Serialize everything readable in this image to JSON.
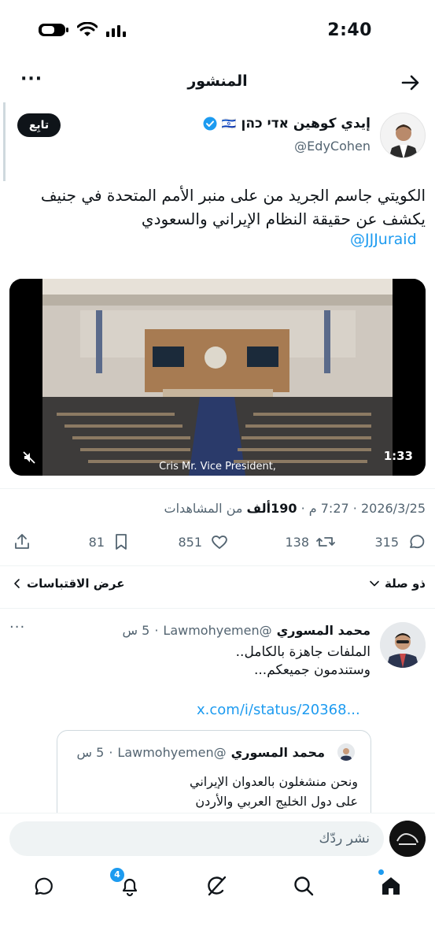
{
  "status_bar": {
    "time": "2:40"
  },
  "header": {
    "title": "المنشور",
    "more_label": "···"
  },
  "tweet": {
    "author_name": "إيدي كوهين אדי כהן",
    "flag": "🇮🇱",
    "handle": "@EdyCohen",
    "follow_label": "تابِع",
    "text": "الكويتي جاسم الجريد من على منبر الأمم المتحدة في جنيف يكشف عن حقيقة النظام الإيراني والسعودي",
    "mention": "@JJJuraid",
    "video": {
      "caption": "Cris Mr. Vice President,",
      "duration": "1:33"
    },
    "meta": {
      "date": "2026/3/25",
      "sep1": " · ",
      "time": "7:27 م",
      "sep2": " · ",
      "views_num": "190",
      "views_unit": "ألف",
      "views_label": " من المشاهدات"
    },
    "actions": {
      "replies": "315",
      "retweets": "138",
      "likes": "851",
      "bookmarks": "81"
    }
  },
  "sort_row": {
    "relevance": "ذو صلة",
    "quotes_label": "عرض الاقتباسات"
  },
  "reply": {
    "author_name": "محمد المسوري",
    "handle": "@Lawmohyemen",
    "dot": "·",
    "time": "5 س",
    "more_label": "···",
    "line1": "الملفات جاهزة بالكامل..",
    "line2": "وستندمون جميعكم...",
    "link": "x.com/i/status/20368...",
    "quote": {
      "author_name": "محمد المسوري",
      "handle": "@Lawmohyemen",
      "dot": "·",
      "time": "5 س",
      "line1": "ونحن منشغلون بالعدوان الإيراني",
      "line2": "على دول الخليج العربي والأردن"
    }
  },
  "compose": {
    "placeholder": "نشر ردّك"
  },
  "nav": {
    "notifications_badge": "4"
  },
  "colors": {
    "accent": "#1d9bf0",
    "text": "#0f1419",
    "secondary": "#536471",
    "verified": "#1d9bf0"
  }
}
